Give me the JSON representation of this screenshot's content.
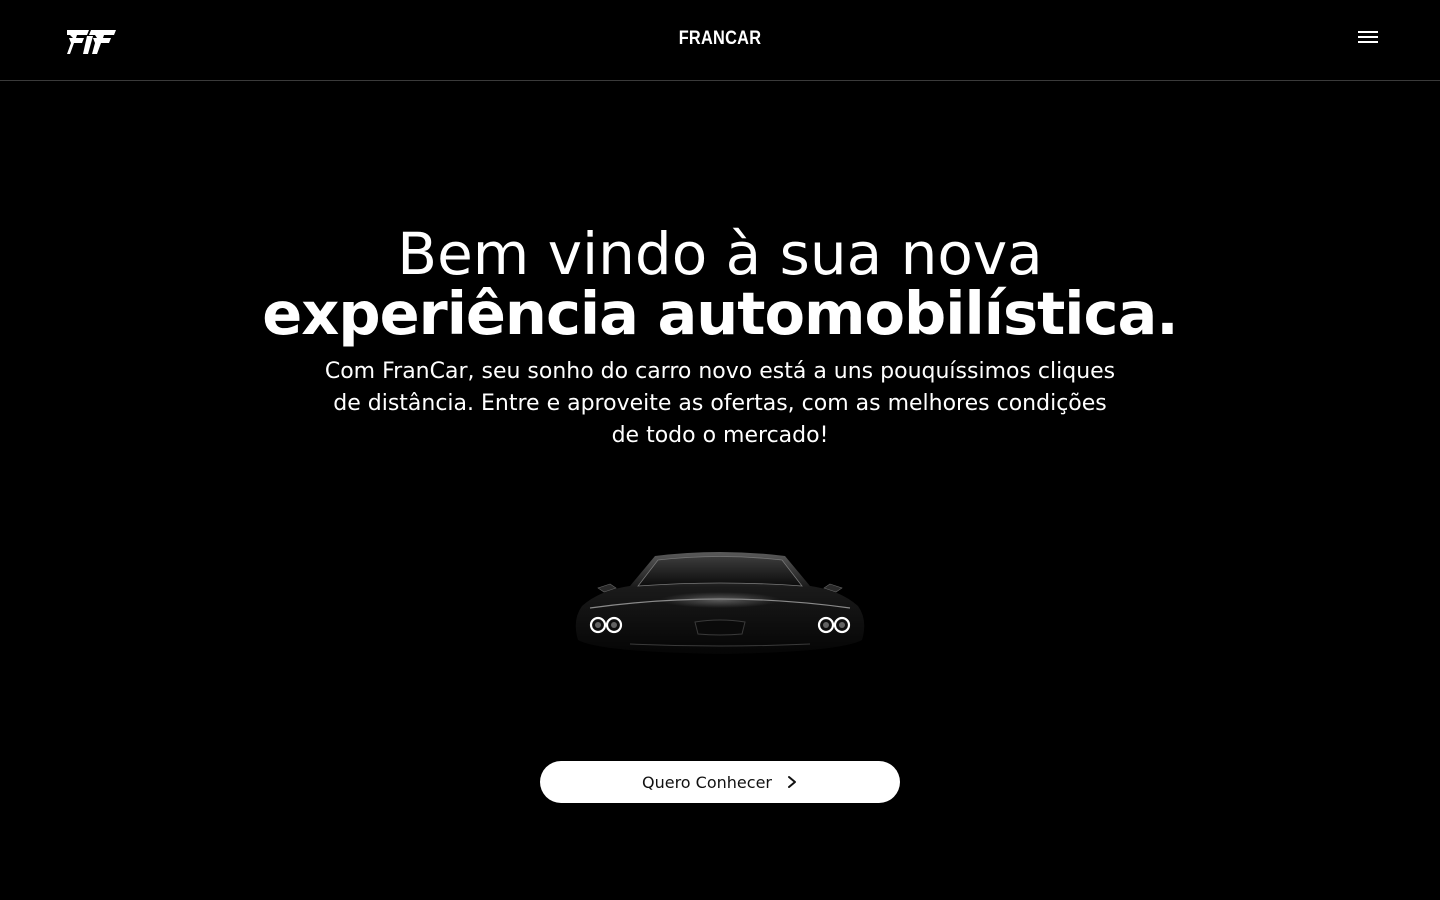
{
  "header": {
    "brand": "FRANCAR",
    "logo_icon": "francar-logo-icon",
    "menu_icon": "hamburger-menu-icon"
  },
  "hero": {
    "headline_light": "Bem vindo à sua nova",
    "headline_bold": "experiência automobilística.",
    "subtext": "Com FranCar, seu sonho do carro novo está a uns pouquíssimos cliques de distância. Entre e aproveite as ofertas, com as melhores condições de todo o mercado!",
    "cta_label": "Quero Conhecer",
    "cta_icon": "chevron-right-icon",
    "image": "car-front-headlights-image"
  },
  "colors": {
    "background": "#000000",
    "text": "#ffffff",
    "cta_background": "#ffffff",
    "cta_text": "#111111"
  }
}
